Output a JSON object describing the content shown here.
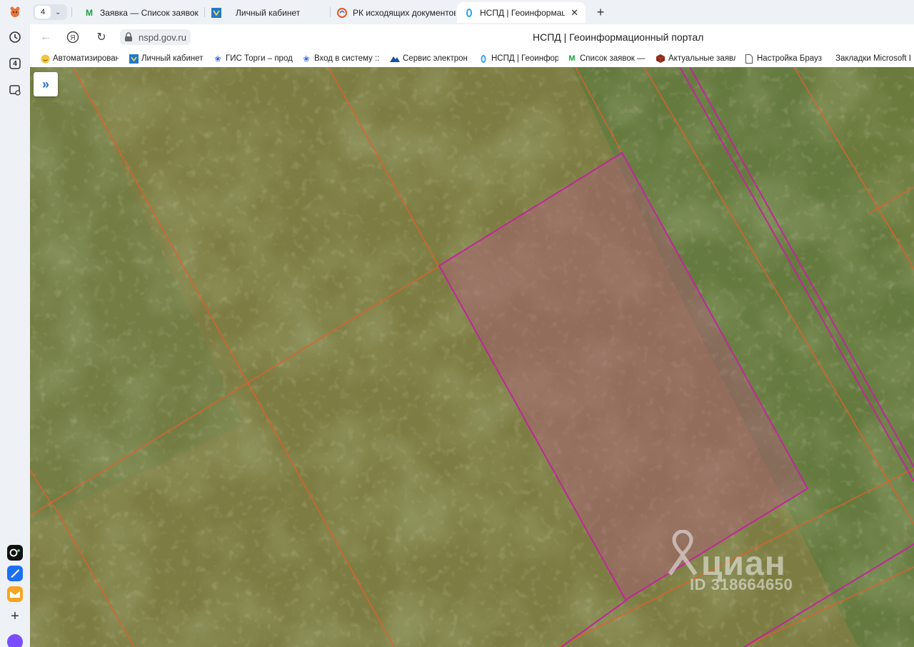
{
  "browser": {
    "tab_count": "4",
    "tabs": [
      {
        "label": "Заявка — Список заявок -",
        "icon": "gmail-m-icon"
      },
      {
        "label": "Личный кабинет",
        "icon": "shield-icon"
      },
      {
        "label": "РК исходящих документов",
        "icon": "swirl-icon"
      },
      {
        "label": "НСПД | Геоинформаци",
        "icon": "nspd-icon",
        "active": true
      }
    ],
    "url": "nspd.gov.ru",
    "page_title": "НСПД | Геоинформационный портал",
    "bookmarks": [
      {
        "label": "Автоматизирован",
        "icon": "smiley-icon"
      },
      {
        "label": "Личный кабинет",
        "icon": "shield-icon"
      },
      {
        "label": "ГИС Торги – прод",
        "icon": "emblem-icon"
      },
      {
        "label": "Вход в систему :: К",
        "icon": "emblem-icon"
      },
      {
        "label": "Сервис электрон",
        "icon": "mountain-icon"
      },
      {
        "label": "НСПД | Геоинфор",
        "icon": "nspd-icon"
      },
      {
        "label": "Список заявок —",
        "icon": "gmail-m-icon"
      },
      {
        "label": "Актуальные заявл",
        "icon": "cube-icon"
      },
      {
        "label": "Настройка Брауз",
        "icon": "page-icon"
      },
      {
        "label": "Закладки Microsoft I",
        "icon": ""
      }
    ],
    "sidebar_badge": "4"
  },
  "map": {
    "expand_label": "»",
    "watermark_brand": "циан",
    "watermark_id": "ID 318664650"
  },
  "colors": {
    "parcel_border": "#c0279a",
    "parcel_fill": "#b05a7a",
    "cadastral_line": "#e0602a",
    "accent": "#1f6fd6"
  }
}
